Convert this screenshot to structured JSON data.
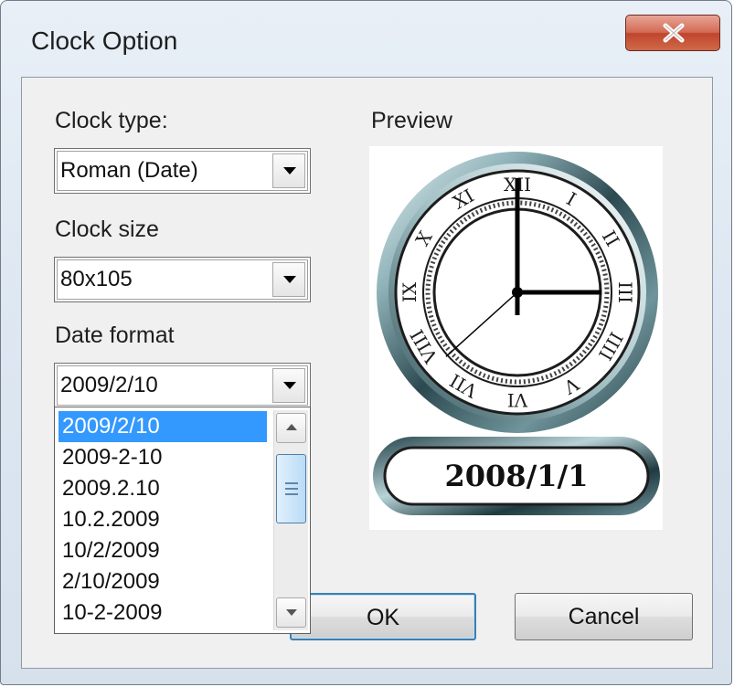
{
  "window": {
    "title": "Clock Option",
    "close_symbol": "X"
  },
  "clock_type": {
    "label": "Clock type:",
    "value": "Roman (Date)"
  },
  "clock_size": {
    "label": "Clock size",
    "value": "80x105"
  },
  "date_format": {
    "label": "Date format",
    "value": "2009/2/10",
    "options": [
      "2009/2/10",
      "2009-2-10",
      "2009.2.10",
      "10.2.2009",
      "10/2/2009",
      "2/10/2009",
      "10-2-2009"
    ],
    "selected_index": 0
  },
  "preview": {
    "label": "Preview",
    "date_text": "2008/1/1",
    "time": {
      "hour": 3,
      "minute": 0,
      "second": 38
    },
    "numerals": [
      "XII",
      "I",
      "II",
      "III",
      "IIII",
      "V",
      "VI",
      "VII",
      "VIII",
      "IX",
      "X",
      "XI"
    ]
  },
  "buttons": {
    "ok": "OK",
    "cancel": "Cancel"
  },
  "icons": {
    "close": "close-icon",
    "dropdown": "chevron-down-icon",
    "scroll_up": "arrow-up-icon",
    "scroll_down": "arrow-down-icon"
  },
  "colors": {
    "selection": "#3399ff",
    "close_button": "#c8462f",
    "default_button_border": "#3c7fb1"
  }
}
